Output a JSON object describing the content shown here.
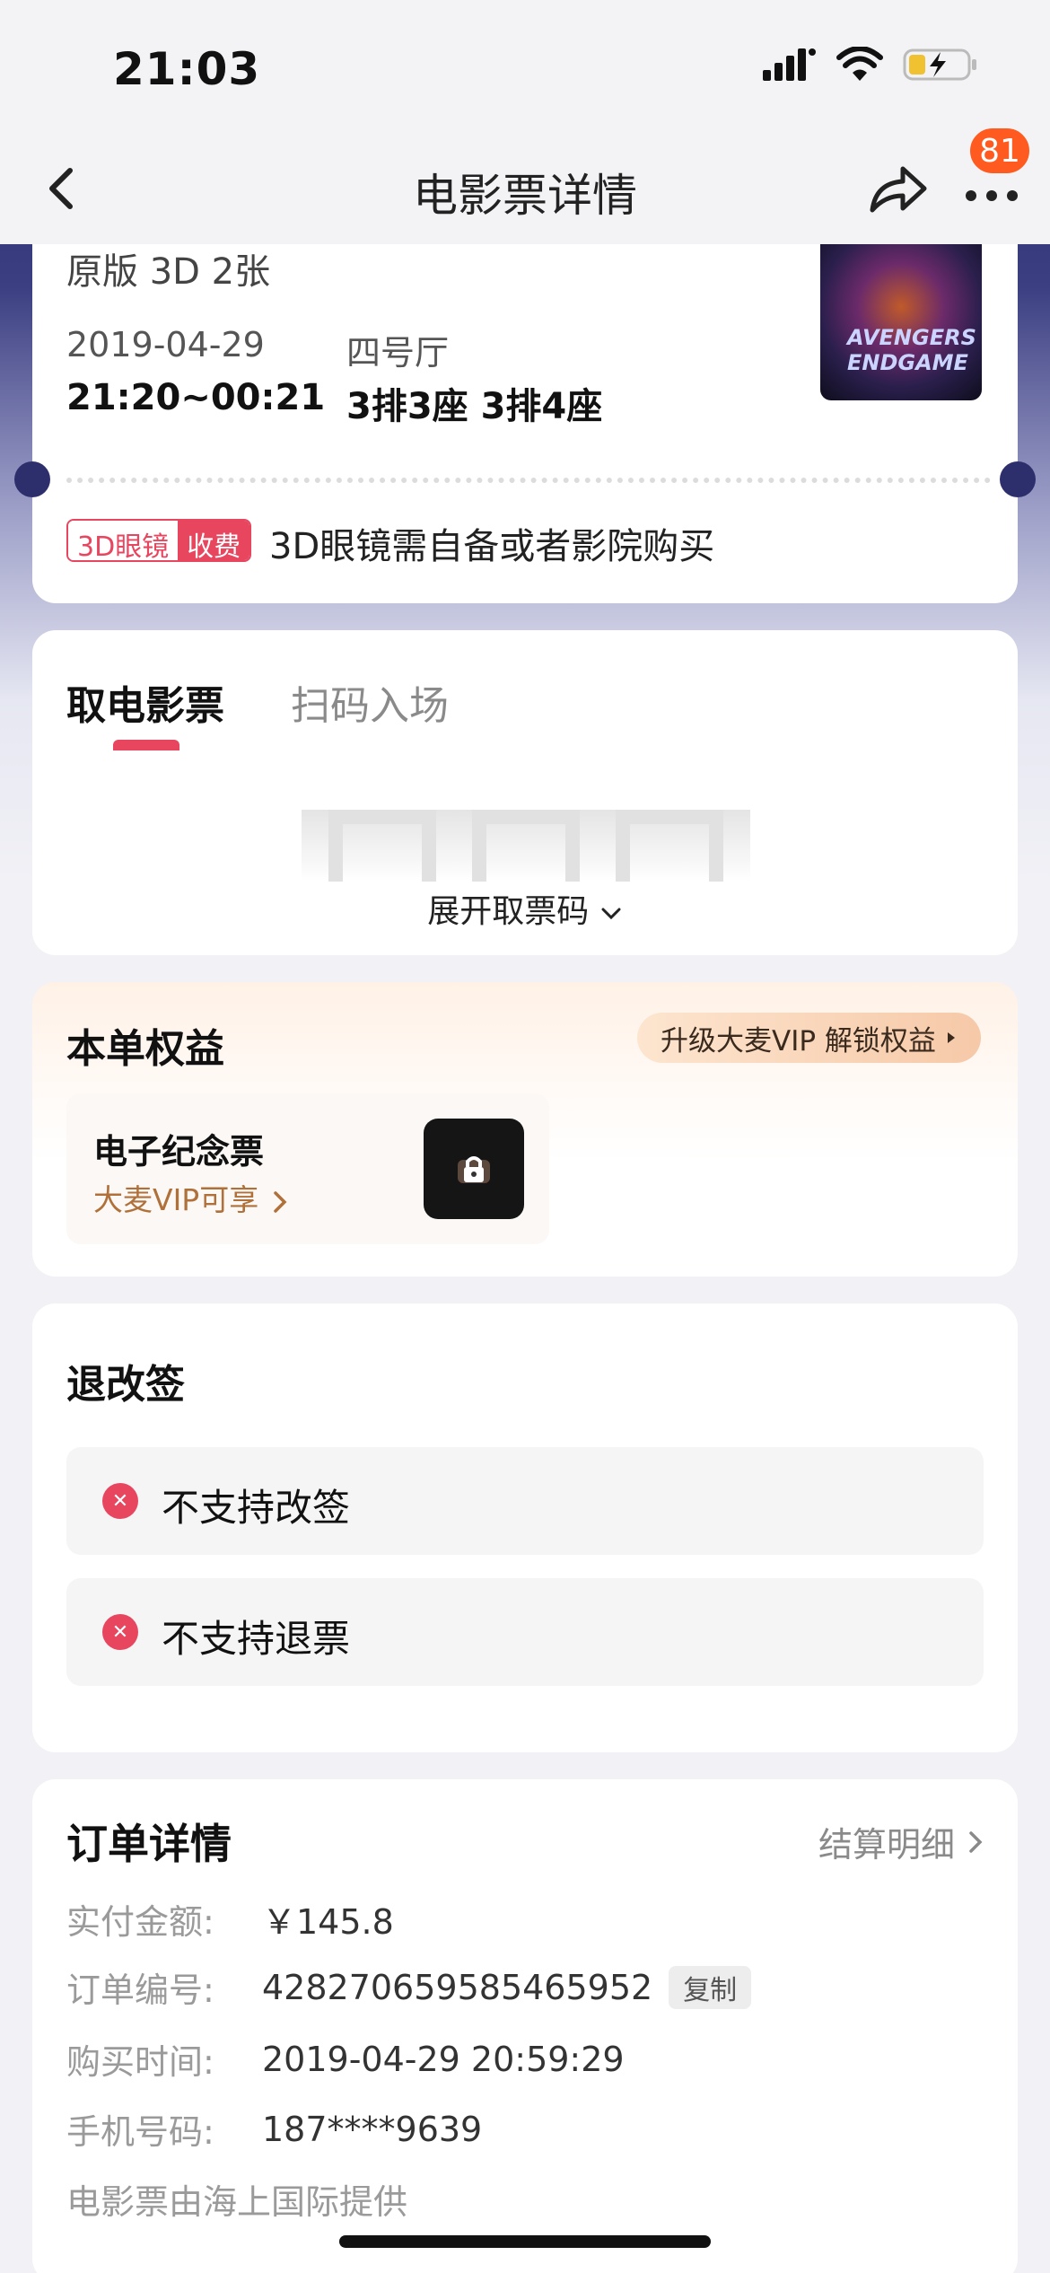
{
  "status_bar": {
    "time": "21:03"
  },
  "nav": {
    "title": "电影票详情",
    "badge": "81"
  },
  "ticket": {
    "version": "原版 3D 2张",
    "date": "2019-04-29",
    "hall": "四号厅",
    "time_range": "21:20~00:21",
    "seats": "3排3座  3排4座",
    "tag_left": "3D眼镜",
    "tag_right": "收费",
    "tag_text": "3D眼镜需自备或者影院购买",
    "poster_text": "AVENGERS ENDGAME"
  },
  "take": {
    "tab_active": "取电影票",
    "tab_other": "扫码入场",
    "expand": "展开取票码"
  },
  "rights": {
    "title": "本单权益",
    "vip_button": "升级大麦VIP 解锁权益",
    "souvenir_title": "电子纪念票",
    "souvenir_sub": "大麦VIP可享"
  },
  "refund": {
    "title": "退改签",
    "items": [
      "不支持改签",
      "不支持退票"
    ]
  },
  "order": {
    "title": "订单详情",
    "settle_link": "结算明细",
    "rows": [
      {
        "key": "实付金额:",
        "value": "￥145.8"
      },
      {
        "key": "订单编号:",
        "value": "428270659585465952"
      },
      {
        "key": "购买时间:",
        "value": "2019-04-29 20:59:29"
      },
      {
        "key": "手机号码:",
        "value": "187****9639"
      }
    ],
    "copy_label": "复制",
    "provider": "电影票由海上国际提供"
  },
  "colors": {
    "accent": "#e8455f",
    "badge": "#ff5a1f",
    "vip_text": "#b0703a"
  }
}
